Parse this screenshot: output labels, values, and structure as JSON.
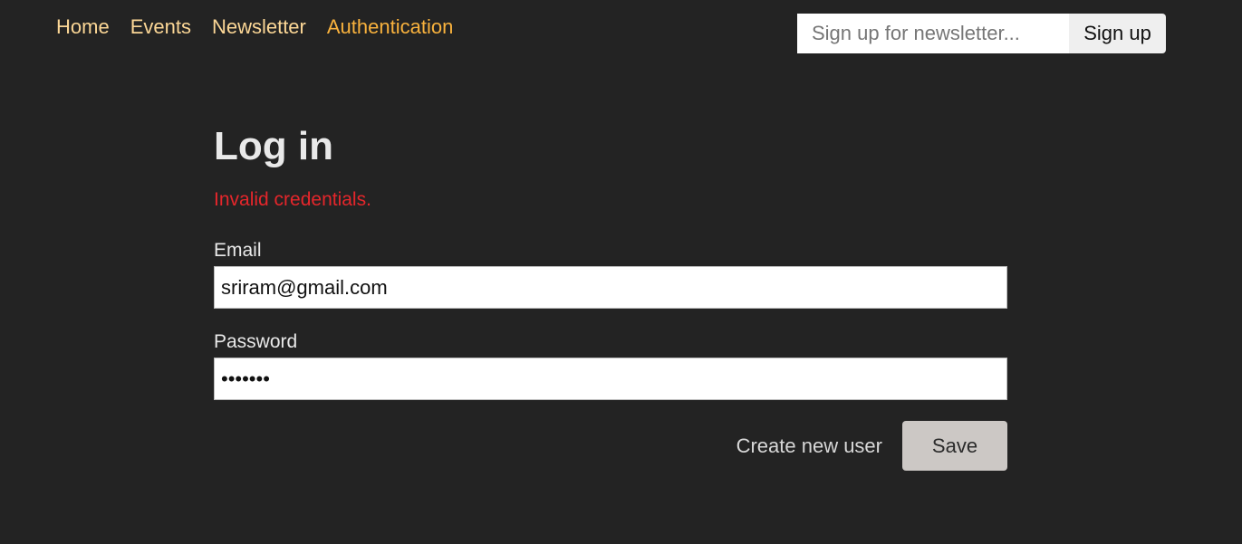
{
  "nav": {
    "items": [
      {
        "label": "Home",
        "active": false
      },
      {
        "label": "Events",
        "active": false
      },
      {
        "label": "Newsletter",
        "active": false
      },
      {
        "label": "Authentication",
        "active": true
      }
    ]
  },
  "newsletter": {
    "placeholder": "Sign up for newsletter...",
    "button_label": "Sign up"
  },
  "form": {
    "title": "Log in",
    "error": "Invalid credentials.",
    "email_label": "Email",
    "email_value": "sriram@gmail.com",
    "password_label": "Password",
    "password_value": "•••••••",
    "create_user_label": "Create new user",
    "save_label": "Save"
  },
  "colors": {
    "background": "#232323",
    "nav_link": "#fcd796",
    "nav_link_active": "#f9b23d",
    "error": "#e5262b",
    "save_button": "#ccc8c5"
  }
}
